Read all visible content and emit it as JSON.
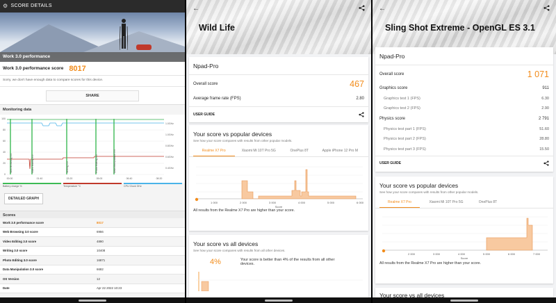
{
  "left_panel": {
    "header": {
      "title": "SCORE DETAILS"
    },
    "hero_label": "Work 3.0 performance",
    "score_label": "Work 3.0 performance score",
    "score_value": "8017",
    "note": "Sorry, we don't have enough data to compare scores for this device.",
    "share_label": "SHARE",
    "monitoring_title": "Monitoring data",
    "chart_y_ticks": [
      "100",
      "80",
      "60",
      "40",
      "20",
      "0"
    ],
    "chart_x_ticks": [
      "00:00",
      "01:40",
      "03:20",
      "05:00",
      "06:40",
      "08:20"
    ],
    "chart_right_ticks": [
      "1.0GHz",
      "1.0GHz",
      "0.8GHz",
      "0.6GHz",
      "0.4GHz"
    ],
    "legend": [
      {
        "label": "Battery charge %",
        "color": "#3cba54"
      },
      {
        "label": "Temperature °C",
        "color": "#c0392b"
      },
      {
        "label": "CPU Clock GHz",
        "color": "#4ab3e8"
      }
    ],
    "chart_annotations": [
      "Web Browsing 3.0",
      "Video Editing 3.0",
      "Writing 3.0",
      "Photo Editing 3.0",
      "Data Manipulation 3.0"
    ],
    "detailed_graph_label": "DETAILED GRAPH",
    "scores_title": "Scores",
    "scores": [
      {
        "name": "Work 3.0 performance score",
        "value": "8017"
      },
      {
        "name": "Web Browsing 3.0 score",
        "value": "6956"
      },
      {
        "name": "Video Editing 3.0 score",
        "value": "4890"
      },
      {
        "name": "Writing 3.0 score",
        "value": "10408"
      },
      {
        "name": "Photo Editing 3.0 score",
        "value": "16871"
      },
      {
        "name": "Data Manipulation 3.0 score",
        "value": "6682"
      },
      {
        "name": "OS Version",
        "value": "12"
      },
      {
        "name": "Date",
        "value": "Apr 22 2022 10:23"
      }
    ]
  },
  "middle_panel": {
    "title": "Wild Life",
    "device": "Npad-Pro",
    "overall_label": "Overall score",
    "overall_value": "467",
    "fps_label": "Average frame rate (FPS)",
    "fps_value": "2.80",
    "user_guide": "USER GUIDE",
    "popular_title": "Your score vs popular devices",
    "popular_desc": "See how your score compares with results from other popular models.",
    "tabs": [
      "Realme X7 Pro",
      "Xiaomi Mi 10T Pro 5G",
      "OnePlus 8T",
      "Apple iPhone 12 Pro M"
    ],
    "axis_ticks": [
      "1 000",
      "2 000",
      "3 000",
      "4 000",
      "5 000",
      "6 000"
    ],
    "axis_label": "Score",
    "popular_foot": "All results from the Realme X7 Pro are higher than your score.",
    "all_title": "Your score vs all devices",
    "all_desc": "See how your score compares with results from all other devices.",
    "all_pct": "4%",
    "all_text": "Your score is better than 4% of the results from all other devices."
  },
  "right_panel": {
    "title": "Sling Shot Extreme - OpenGL ES 3.1",
    "device": "Npad-Pro",
    "overall_label": "Overall score",
    "overall_value": "1 071",
    "rows": [
      {
        "label": "Graphics score",
        "value": "911",
        "sub": false
      },
      {
        "label": "Graphics test 1 (FPS)",
        "value": "6.30",
        "sub": true
      },
      {
        "label": "Graphics test 2 (FPS)",
        "value": "2.90",
        "sub": true
      },
      {
        "label": "Physics score",
        "value": "2 791",
        "sub": false
      },
      {
        "label": "Physics test part 1 (FPS)",
        "value": "51.60",
        "sub": true
      },
      {
        "label": "Physics test part 2 (FPS)",
        "value": "28.80",
        "sub": true
      },
      {
        "label": "Physics test part 3 (FPS)",
        "value": "15.50",
        "sub": true
      }
    ],
    "user_guide": "USER GUIDE",
    "popular_title": "Your score vs popular devices",
    "popular_desc": "See how your score compares with results from other popular models.",
    "tabs": [
      "Realme X7 Pro",
      "Xiaomi Mi 10T Pro 5G",
      "OnePlus 8T"
    ],
    "axis_ticks": [
      "2 000",
      "3 000",
      "4 000",
      "5 000",
      "6 000",
      "7 000"
    ],
    "axis_label": "Score",
    "popular_foot": "All results from the Realme X7 Pro are higher than your score.",
    "all_title": "Your score vs all devices"
  },
  "colors": {
    "accent": "#f28c1b",
    "bar_fill": "#f8c9a0",
    "bar_stroke": "#e69552"
  }
}
